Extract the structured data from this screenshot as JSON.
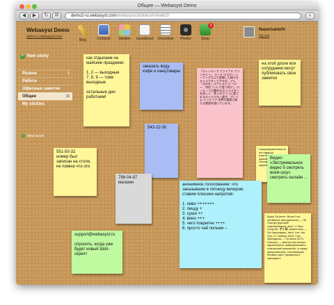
{
  "window": {
    "title": "Общее — Webasyst Demo"
  },
  "browser": {
    "url_host": "demo2-ru.webasyst.com",
    "url_path": "/webasyst/stickies/#/sheet/1/",
    "back_label": "◀",
    "forward_label": "▶",
    "reload_label": "↻",
    "bookmark_label": "✉"
  },
  "header": {
    "brand_name": "Webasyst Demo",
    "brand_link": "demo-ru.webasyst.com",
    "apps": [
      {
        "label": "Blog",
        "icon": "pen-icon",
        "color": "#e6b93b"
      },
      {
        "label": "Contacts",
        "icon": "contacts-icon",
        "color": "#4a78c2"
      },
      {
        "label": "Stickies",
        "icon": "stickies-icon",
        "color": "#e7c743"
      },
      {
        "label": "Guestbook",
        "icon": "guestbook-icon",
        "color": "#f0f0f0"
      },
      {
        "label": "Checklists",
        "icon": "checklist-icon",
        "color": "#f4f4f4"
      },
      {
        "label": "Photos",
        "icon": "camera-icon",
        "color": "#3a3a3a"
      },
      {
        "label": "Shop",
        "icon": "cart-icon",
        "color": "#3fa63f",
        "badge": "2"
      }
    ],
    "user_name": "Nasername%",
    "user_logout": "log out"
  },
  "sidebar": {
    "new_sticky": "New sticky",
    "sheets": [
      {
        "label": "Разное",
        "count": "5"
      },
      {
        "label": "Работа",
        "count": ""
      },
      {
        "label": "Офисные заметки",
        "count": ""
      },
      {
        "label": "Общее",
        "count": "15",
        "active": true
      },
      {
        "label": "My stickies",
        "count": ""
      }
    ],
    "new_board": "New board"
  },
  "notes": [
    {
      "id": "n1",
      "color": "yellow",
      "text": "как отдыхаем на майские праздники:\n\n1, 2 — выходные\n7, 8, 9 — тоже выходные\n\nостальные дни работаем!"
    },
    {
      "id": "n2",
      "color": "blue",
      "text": "заказать воду, кофе и канцтовары"
    },
    {
      "id": "n3",
      "color": "pink",
      "text": "『ディンディア ファイナル ファンタジー』 ルーフ ウスター シーニングスより登場した様々なキャラクターとやるの、アシ「まのれ」スペシャル ヒーロー、特別「いいで登つ所ア」 ロール ーで活動中のキャラクターを詳しく、多くのファンに愛されるキャラクター達が、フレイム インテリア 世界の冒険と新たな物語を描いています。"
    },
    {
      "id": "n4",
      "color": "yellow",
      "text": "на этой доске все сотрудники могут публиковать свои заметки"
    },
    {
      "id": "n5",
      "color": "blue",
      "text": "543-22-30"
    },
    {
      "id": "n6",
      "color": "yellow",
      "text": "551-50-32\nномер был записан на столе, не помню что это"
    },
    {
      "id": "n7",
      "color": "yellow",
      "text": "Супермаркетенность на подарок участникам для заказа. Постарайтесь заранее быстро."
    },
    {
      "id": "n8",
      "color": "green",
      "text": "Видео\n«Экстремальное видео 5 смотреть всем шоу» смотреть онлайн ..."
    },
    {
      "id": "n9",
      "color": "grey",
      "text": "798-04-97 магазин"
    },
    {
      "id": "n10",
      "color": "cyan",
      "text": "анонимное голосование: что заказываем в пятницу вечером. ставим плюсики напротив:\n\n1. пиво +++++++\n2. пиццу +\n3. суши ++\n4. вино +++\n5. чего покрепче ++++\n6. просто чай попьем –"
    },
    {
      "id": "n11",
      "color": "yellow",
      "text": "Брюс Ли (англ. Bruce Lee; китайское имя (детское) — Ли Сяолун (русская транскрипция), англ. Li Xiao Long кит. 李小龍, (взрослое) — Ли Чжэньфань, англ. Lee Jun Fan; 27 ноября 1940, Сан-Франциско — 20 июля 1973, Гонконг) — мастер восточных единоборств, американский и гонконгский киноактёр, а также кинорежиссёр, постановщик боевых сцен, продюсер и сценарист."
    },
    {
      "id": "n12",
      "color": "green",
      "text": "support@webasyst.ru\n\nспросить, когда уже будет новый Шоп-скрипт"
    }
  ]
}
